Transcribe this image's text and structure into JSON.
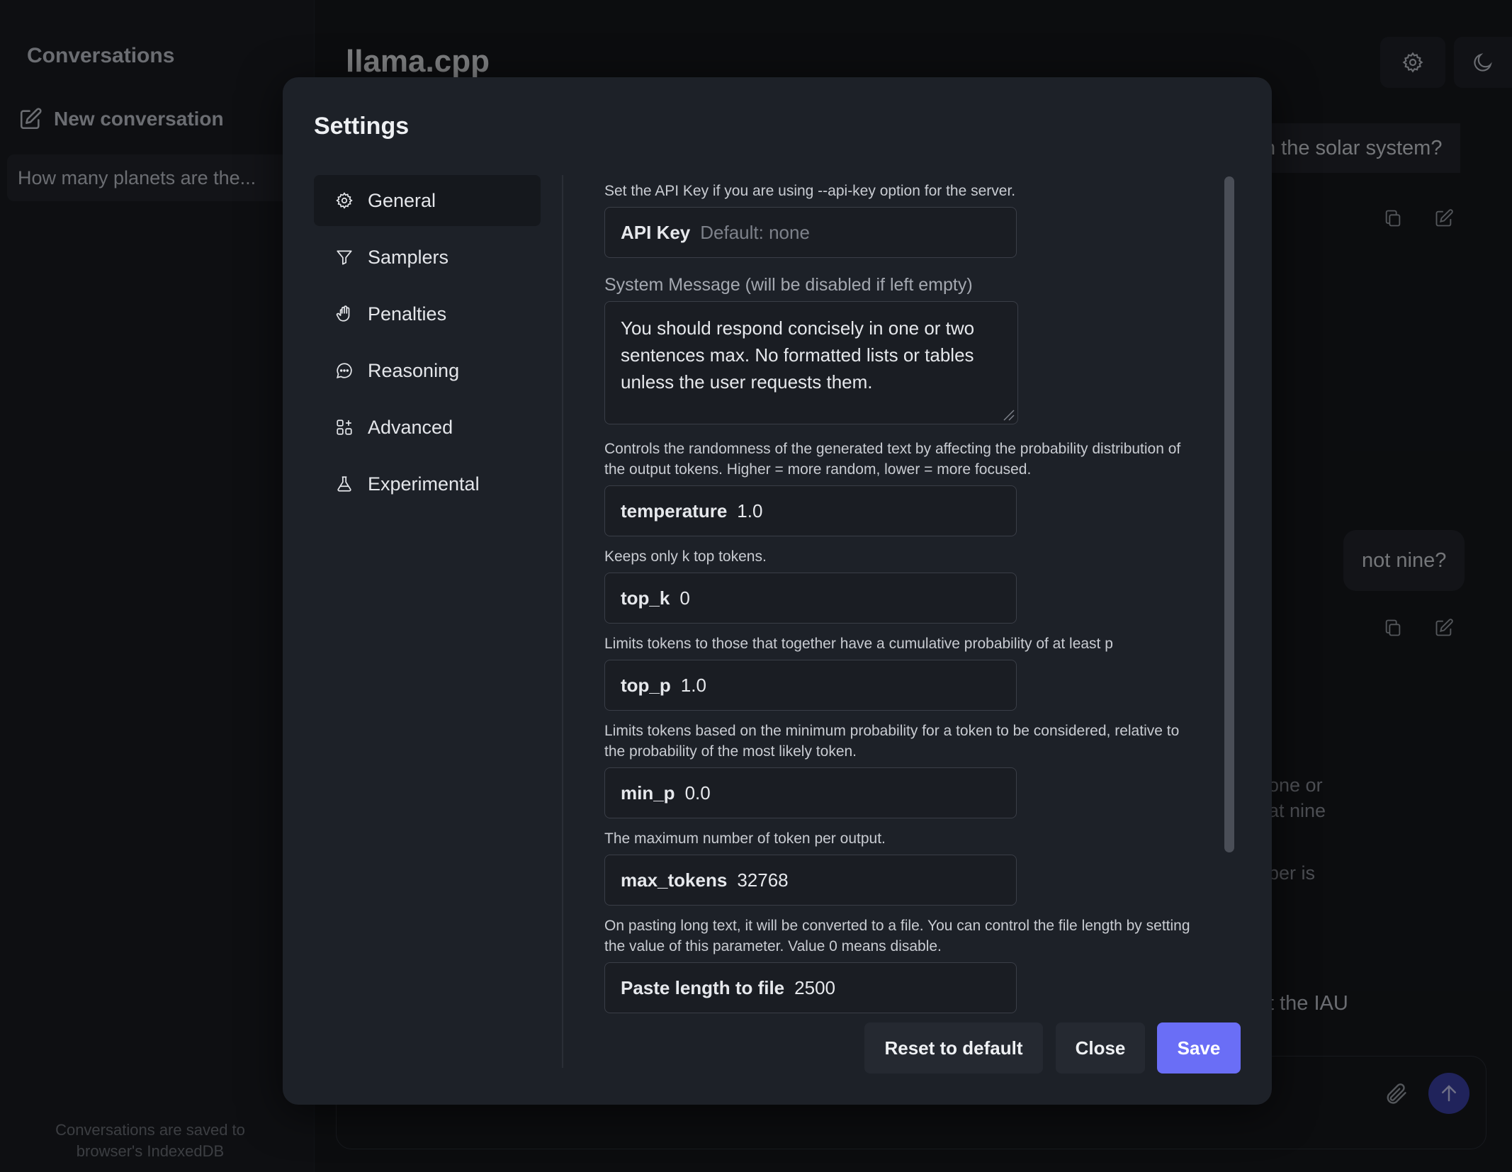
{
  "sidebar": {
    "title": "Conversations",
    "new_conversation": "New conversation",
    "conversations": [
      "How many planets are the..."
    ],
    "footer_line1": "Conversations are saved to",
    "footer_line2": "browser's IndexedDB"
  },
  "header": {
    "title": "llama.cpp",
    "settings_icon": "gear-icon",
    "theme_icon": "moon-icon"
  },
  "chat": {
    "user_msg_1": "n the solar system?",
    "user_msg_2": "not nine?",
    "partial_line_1": "one or",
    "partial_line_2": "at nine",
    "partial_line_3": "per is",
    "partial_line_4": "t the IAU"
  },
  "settings": {
    "title": "Settings",
    "tabs": [
      {
        "label": "General",
        "icon": "gear-icon"
      },
      {
        "label": "Samplers",
        "icon": "funnel-icon"
      },
      {
        "label": "Penalties",
        "icon": "hand-icon"
      },
      {
        "label": "Reasoning",
        "icon": "chat-bubble-icon"
      },
      {
        "label": "Advanced",
        "icon": "squares-icon"
      },
      {
        "label": "Experimental",
        "icon": "beaker-icon"
      }
    ],
    "api_key": {
      "desc": "Set the API Key if you are using --api-key option for the server.",
      "label": "API Key",
      "placeholder": "Default: none"
    },
    "system_message": {
      "label": "System Message (will be disabled if left empty)",
      "value": "You should respond concisely in one or two sentences max. No formatted lists or tables unless the user requests them."
    },
    "temperature": {
      "desc": "Controls the randomness of the generated text by affecting the probability distribution of the output tokens. Higher = more random, lower = more focused.",
      "label": "temperature",
      "value": "1.0"
    },
    "top_k": {
      "desc": "Keeps only k top tokens.",
      "label": "top_k",
      "value": "0"
    },
    "top_p": {
      "desc": "Limits tokens to those that together have a cumulative probability of at least p",
      "label": "top_p",
      "value": "1.0"
    },
    "min_p": {
      "desc": "Limits tokens based on the minimum probability for a token to be considered, relative to the probability of the most likely token.",
      "label": "min_p",
      "value": "0.0"
    },
    "max_tokens": {
      "desc": "The maximum number of token per output.",
      "label": "max_tokens",
      "value": "32768"
    },
    "paste_length": {
      "desc": "On pasting long text, it will be converted to a file. You can control the file length by setting the value of this parameter. Value 0 means disable.",
      "label": "Paste length to file",
      "value": "2500"
    },
    "buttons": {
      "reset": "Reset to default",
      "close": "Close",
      "save": "Save"
    }
  },
  "colors": {
    "accent": "#6a6ef6",
    "modal_bg": "#1d2128",
    "page_bg": "#16181d"
  }
}
